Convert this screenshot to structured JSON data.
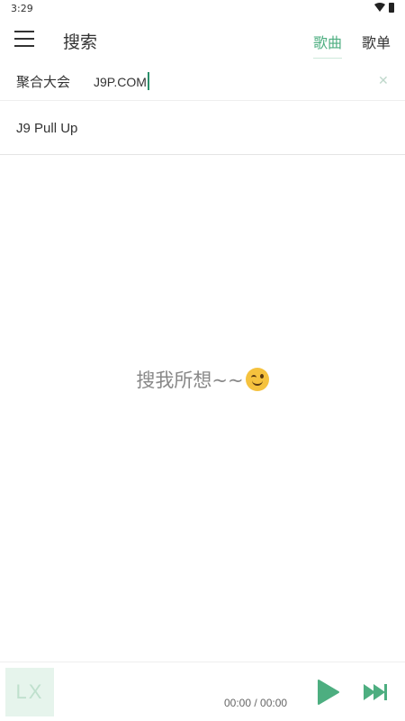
{
  "status_bar": {
    "time": "3:29"
  },
  "header": {
    "title": "搜索",
    "tabs": [
      {
        "label": "歌曲",
        "active": true
      },
      {
        "label": "歌单",
        "active": false
      }
    ]
  },
  "search": {
    "source": "聚合大会",
    "value": "J9P.COM",
    "placeholder": ""
  },
  "suggestions": [
    {
      "text": "J9  Pull Up"
    }
  ],
  "empty_state": {
    "text": "搜我所想~~"
  },
  "player": {
    "album_placeholder": "LX",
    "time": "00:00 / 00:00"
  },
  "colors": {
    "accent": "#4dae80",
    "accent_light": "#e6f4ec"
  }
}
